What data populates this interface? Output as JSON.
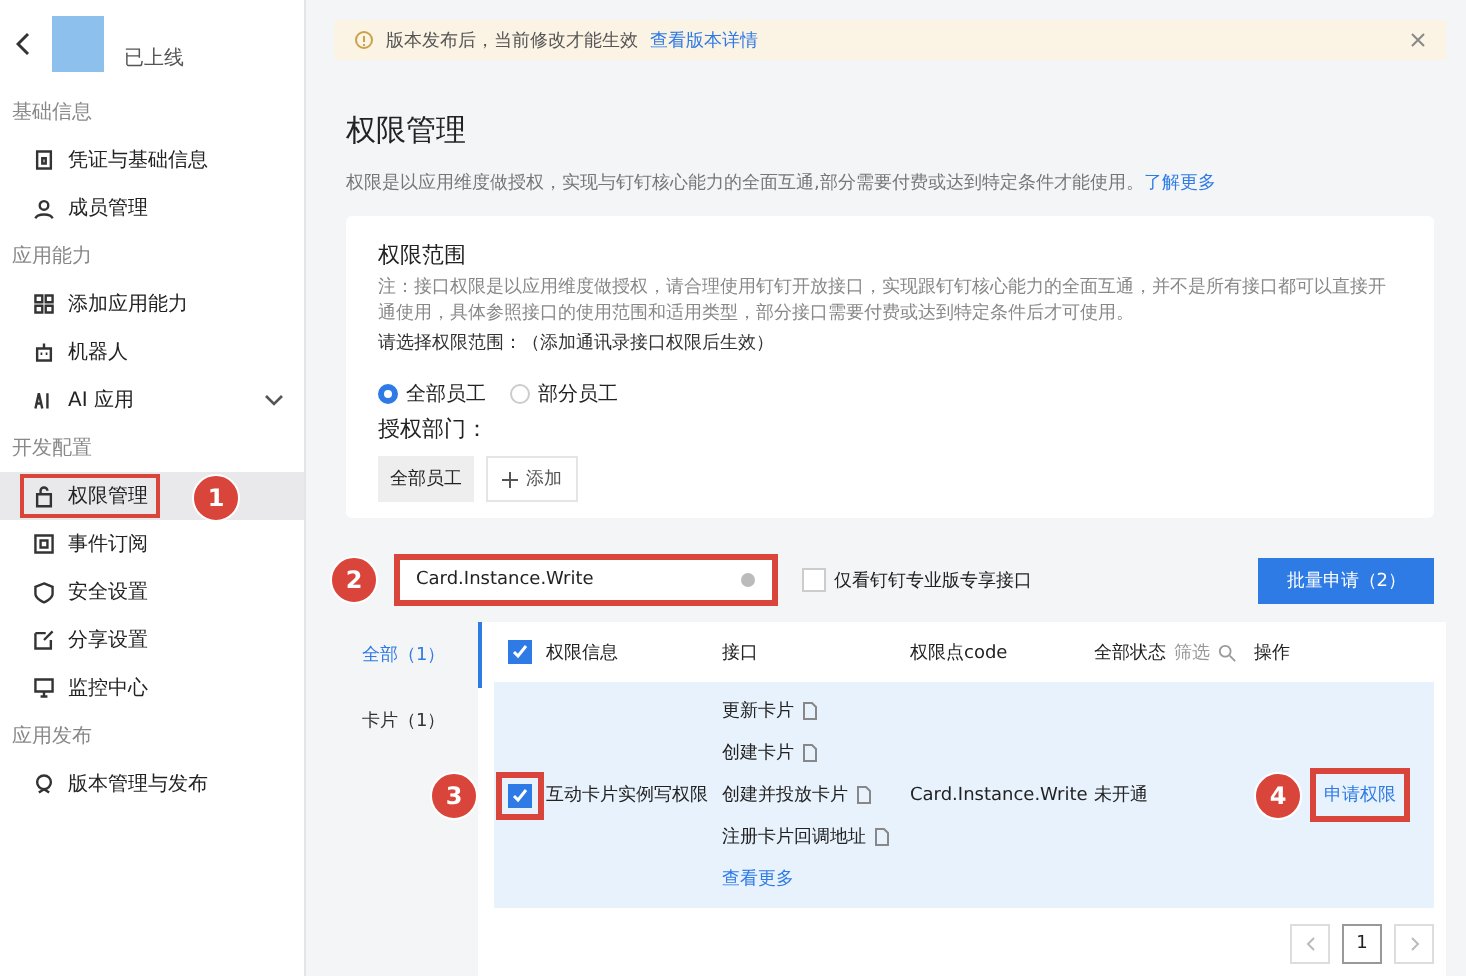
{
  "sidebar": {
    "status": "已上线",
    "groups": [
      {
        "title": "基础信息",
        "items": [
          {
            "label": "凭证与基础信息",
            "selected": false,
            "highlighted": false
          },
          {
            "label": "成员管理",
            "selected": false,
            "highlighted": false
          }
        ]
      },
      {
        "title": "应用能力",
        "items": [
          {
            "label": "添加应用能力",
            "selected": false,
            "highlighted": false
          },
          {
            "label": "机器人",
            "selected": false,
            "highlighted": false
          },
          {
            "label": "AI 应用",
            "selected": false,
            "highlighted": false,
            "expandable": true
          }
        ]
      },
      {
        "title": "开发配置",
        "items": [
          {
            "label": "权限管理",
            "selected": true,
            "highlighted": true,
            "callout": "1"
          },
          {
            "label": "事件订阅",
            "selected": false,
            "highlighted": false
          },
          {
            "label": "安全设置",
            "selected": false,
            "highlighted": false
          },
          {
            "label": "分享设置",
            "selected": false,
            "highlighted": false
          },
          {
            "label": "监控中心",
            "selected": false,
            "highlighted": false
          }
        ]
      },
      {
        "title": "应用发布",
        "items": [
          {
            "label": "版本管理与发布",
            "selected": false,
            "highlighted": false
          }
        ]
      }
    ]
  },
  "notice": {
    "text": "版本发布后，当前修改才能生效",
    "link": "查看版本详情"
  },
  "page_title": "权限管理",
  "description": {
    "text": "权限是以应用维度做授权，实现与钉钉核心能力的全面互通,部分需要付费或达到特定条件才能使用。",
    "link": "了解更多"
  },
  "scope": {
    "title": "权限范围",
    "note": "注：接口权限是以应用维度做授权，请合理使用钉钉开放接口，实现跟钉钉核心能力的全面互通，并不是所有接口都可以直接开通使用，具体参照接口的使用范围和适用类型，部分接口需要付费或达到特定条件后才可使用。",
    "prompt": "请选择权限范围：（添加通讯录接口权限后生效）",
    "radios": [
      {
        "label": "全部员工",
        "selected": true
      },
      {
        "label": "部分员工",
        "selected": false
      }
    ],
    "dept_label": "授权部门：",
    "dept_tags": [
      "全部员工"
    ],
    "add_button": "添加"
  },
  "toolbar": {
    "search": {
      "value": "Card.Instance.Write",
      "highlighted": true,
      "callout": "2"
    },
    "filter_checkbox": {
      "label": "仅看钉钉专业版专享接口",
      "checked": false
    },
    "batch_button": "批量申请（2）"
  },
  "categories": [
    {
      "label": "全部（1）",
      "selected": true
    },
    {
      "label": "卡片（1）",
      "selected": false
    }
  ],
  "table": {
    "columns": [
      "权限信息",
      "接口",
      "权限点code",
      "全部状态",
      "操作"
    ],
    "filter": "筛选",
    "all_checked": true,
    "rows": [
      {
        "checked": true,
        "highlighted": true,
        "callout": "3",
        "name": "互动卡片实例写权限",
        "apis": [
          "更新卡片",
          "创建卡片",
          "创建并投放卡片",
          "注册卡片回调地址"
        ],
        "more": "查看更多",
        "code": "Card.Instance.Write",
        "status": "未开通",
        "action": "申请权限",
        "action_highlighted": true,
        "action_callout": "4"
      }
    ]
  },
  "pagination": {
    "page": "1"
  }
}
